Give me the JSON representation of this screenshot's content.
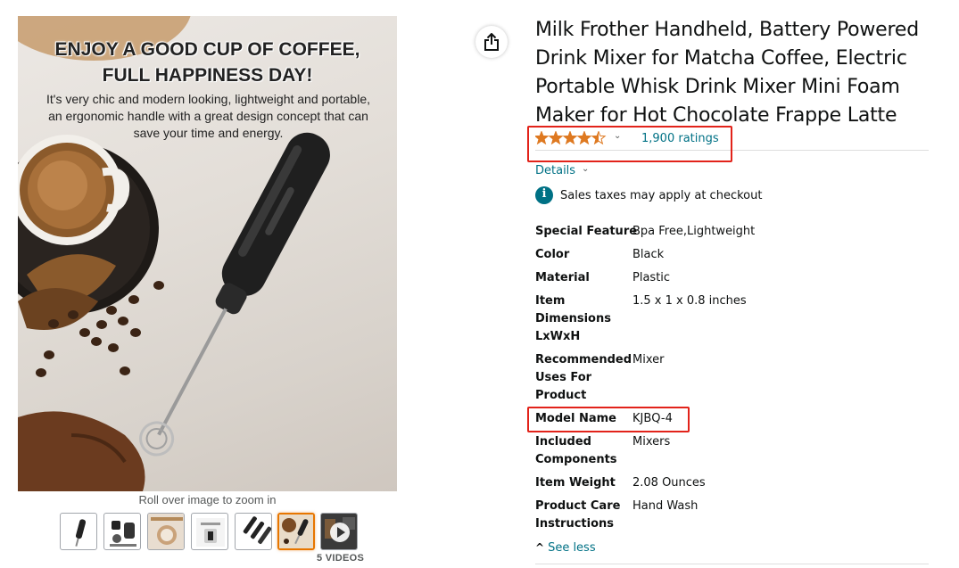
{
  "image": {
    "headline_line1": "ENJOY A GOOD CUP OF COFFEE,",
    "headline_line2": "FULL HAPPINESS DAY!",
    "sub_line1": "It's very chic and modern looking, lightweight and portable,",
    "sub_line2": "an ergonomic handle with a great design concept that can",
    "sub_line3": "save your time and energy."
  },
  "zoom_hint": "Roll over image to zoom in",
  "thumbnails_count": 7,
  "active_thumbnail_index": 5,
  "videos_label": "5 VIDEOS",
  "product": {
    "title_lines": [
      "Milk Frother Handheld, Battery Powered",
      "Drink Mixer for Matcha Coffee, Electric",
      "Portable Whisk Drink Mixer Mini Foam",
      "Maker for Hot Chocolate Frappe Latte"
    ],
    "rating_stars": 4.5,
    "rating_chevron": "⌄",
    "ratings_count": "1,900 ratings",
    "details_label": "Details",
    "details_chevron": "⌄",
    "tax_icon": "i",
    "tax_text": "Sales taxes may apply at checkout"
  },
  "specs": [
    {
      "key_lines": [
        "Special Feature"
      ],
      "value": "Bpa Free,Lightweight"
    },
    {
      "key_lines": [
        "Color"
      ],
      "value": "Black"
    },
    {
      "key_lines": [
        "Material"
      ],
      "value": "Plastic"
    },
    {
      "key_lines": [
        "Item",
        "Dimensions",
        "LxWxH"
      ],
      "value": "1.5 x 1 x 0.8 inches"
    },
    {
      "key_lines": [
        "Recommended",
        "Uses For",
        "Product"
      ],
      "value": "Mixer"
    },
    {
      "key_lines": [
        "Model Name"
      ],
      "value": "KJBQ-4"
    },
    {
      "key_lines": [
        "Included",
        "Components"
      ],
      "value": "Mixers"
    },
    {
      "key_lines": [
        "Item Weight"
      ],
      "value": "2.08 Ounces"
    },
    {
      "key_lines": [
        "Product Care",
        "Instructions"
      ],
      "value": "Hand Wash"
    }
  ],
  "see_less": "See less",
  "see_less_chevron": "^",
  "colors": {
    "link": "#007185",
    "star": "#de7921",
    "highlight_box": "#e2231a",
    "active_thumb": "#e77600"
  },
  "icons": {
    "share": "share-icon",
    "star": "star-icon",
    "info": "info-icon",
    "play": "play-icon"
  }
}
